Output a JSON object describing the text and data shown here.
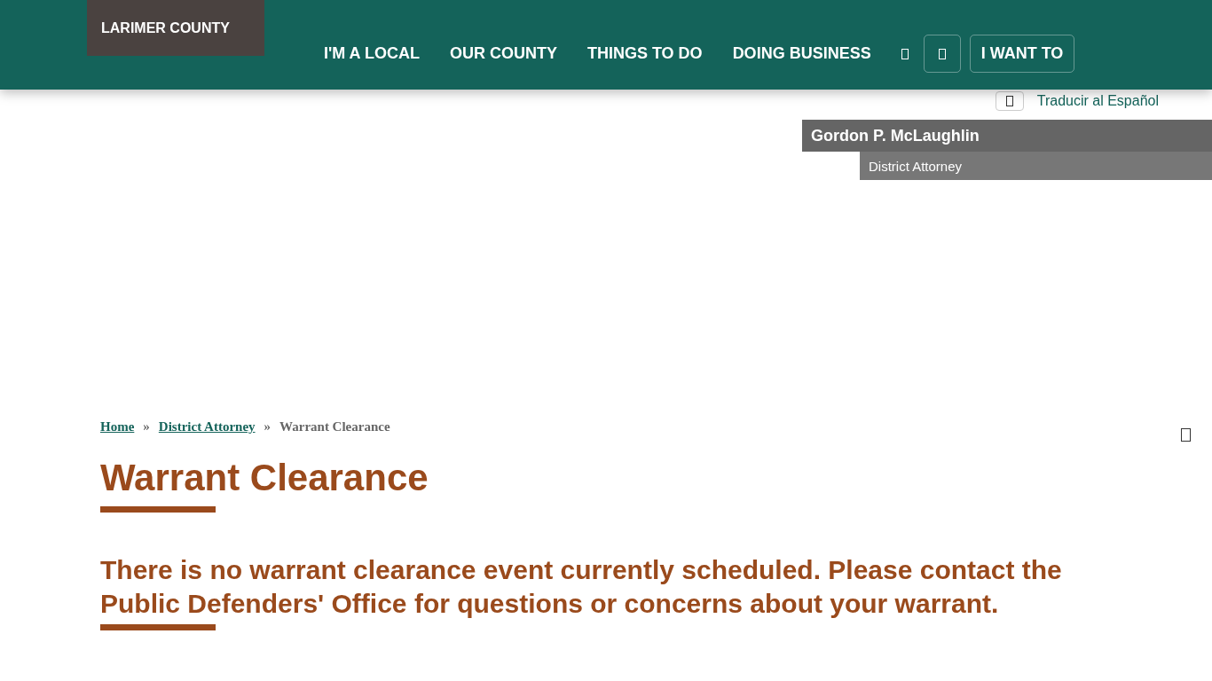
{
  "header": {
    "logo": "LARIMER COUNTY",
    "nav": [
      {
        "label": "I'M A LOCAL"
      },
      {
        "label": "OUR COUNTY"
      },
      {
        "label": "THINGS TO DO"
      },
      {
        "label": "DOING BUSINESS"
      }
    ],
    "cta": "I WANT TO"
  },
  "translate": "Traducir al Español",
  "official": {
    "name": "Gordon P. McLaughlin",
    "title": "District Attorney"
  },
  "breadcrumb": [
    {
      "label": "Home",
      "link": true
    },
    {
      "label": "»",
      "link": false
    },
    {
      "label": "District Attorney",
      "link": true
    },
    {
      "label": "»",
      "link": false
    },
    {
      "label": "Warrant Clearance",
      "link": false
    }
  ],
  "page_title": "Warrant Clearance",
  "notice": "There is no warrant clearance event currently scheduled. Please contact the Public Defenders' Office for questions or concerns about your warrant."
}
